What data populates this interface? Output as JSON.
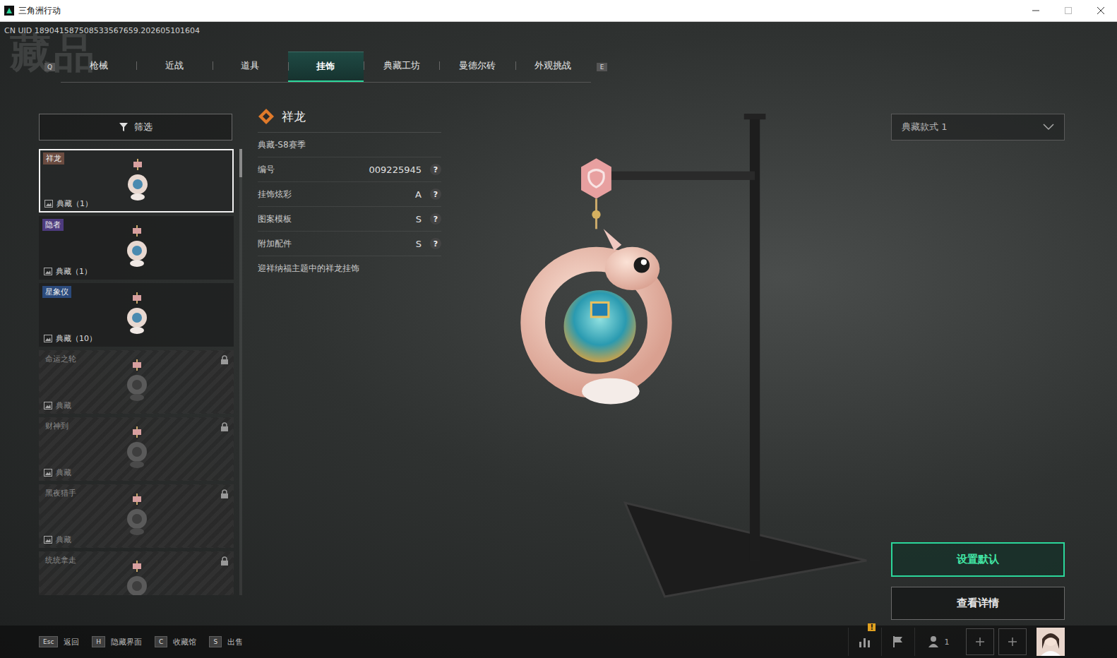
{
  "window": {
    "title": "三角洲行动"
  },
  "uid": "CN UID 189041587508533567659.202605101604",
  "page_title": "藏品",
  "tab_keys": {
    "prev": "Q",
    "next": "E"
  },
  "tabs": [
    {
      "label": "枪械",
      "selected": false
    },
    {
      "label": "近战",
      "selected": false
    },
    {
      "label": "道具",
      "selected": false
    },
    {
      "label": "挂饰",
      "selected": true
    },
    {
      "label": "典藏工坊",
      "selected": false
    },
    {
      "label": "曼德尔砖",
      "selected": false
    },
    {
      "label": "外观挑战",
      "selected": false
    }
  ],
  "filter": {
    "label": "筛选"
  },
  "items": [
    {
      "name": "祥龙",
      "count": "典藏（1）",
      "selected": true,
      "locked": false,
      "color": "#6a4b40"
    },
    {
      "name": "隐者",
      "count": "典藏（1）",
      "selected": false,
      "locked": false,
      "color": "#4d3b7e"
    },
    {
      "name": "星象仪",
      "count": "典藏（10）",
      "selected": false,
      "locked": false,
      "color": "#2b4a7c"
    },
    {
      "name": "命运之轮",
      "count": "典藏",
      "selected": false,
      "locked": true,
      "color": "#3a3a3a"
    },
    {
      "name": "财神到",
      "count": "典藏",
      "selected": false,
      "locked": true,
      "color": "#3a3a3a"
    },
    {
      "name": "黑夜猎手",
      "count": "典藏",
      "selected": false,
      "locked": true,
      "color": "#3a3a3a"
    },
    {
      "name": "统统拿走",
      "selected": false,
      "locked": true,
      "color": "#3a3a3a"
    }
  ],
  "detail": {
    "title": "祥龙",
    "season": "典藏-S8赛季",
    "rows": [
      {
        "label": "编号",
        "value": "009225945",
        "help": "?"
      },
      {
        "label": "挂饰炫彩",
        "value": "A",
        "help": "?"
      },
      {
        "label": "图案模板",
        "value": "S",
        "help": "?"
      },
      {
        "label": "附加配件",
        "value": "S",
        "help": "?"
      }
    ],
    "description": "迎祥纳福主题中的祥龙挂饰"
  },
  "style_select": {
    "value": "典藏款式 1"
  },
  "buttons": [
    {
      "label": "设置默认",
      "primary": true
    },
    {
      "label": "查看详情",
      "primary": false
    }
  ],
  "hints": [
    {
      "key": "Esc",
      "label": "返回"
    },
    {
      "key": "H",
      "label": "隐藏界面"
    },
    {
      "key": "C",
      "label": "收藏馆"
    },
    {
      "key": "S",
      "label": "出售"
    }
  ],
  "tray": {
    "friends": "1",
    "alert": "!"
  }
}
